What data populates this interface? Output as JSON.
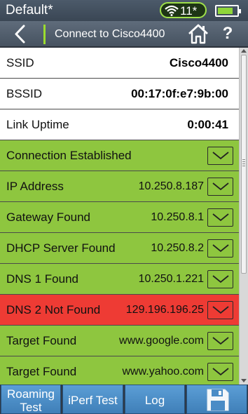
{
  "status_bar": {
    "profile": "Default*",
    "wifi_count": "11*",
    "wifi_icon": "wifi-icon",
    "battery_level": 0.8,
    "colors": {
      "wifi_accent": "#9fe04a",
      "battery_fill": "#8fd63a"
    }
  },
  "nav": {
    "back_icon": "chevron-left-icon",
    "title": "Connect to Cisco4400",
    "home_icon": "home-icon",
    "help_label": "?"
  },
  "rows": [
    {
      "label": "SSID",
      "value": "Cisco4400",
      "style": "white"
    },
    {
      "label": "BSSID",
      "value": "00:17:0f:e7:9b:00",
      "style": "white"
    },
    {
      "label": "Link Uptime",
      "value": "0:00:41",
      "style": "white"
    },
    {
      "label": "Connection Established",
      "value": "",
      "style": "green"
    },
    {
      "label": "IP Address",
      "value": "10.250.8.187",
      "style": "green"
    },
    {
      "label": "Gateway Found",
      "value": "10.250.8.1",
      "style": "green"
    },
    {
      "label": "DHCP Server Found",
      "value": "10.250.8.2",
      "style": "green"
    },
    {
      "label": "DNS 1 Found",
      "value": "10.250.1.221",
      "style": "green"
    },
    {
      "label": "DNS 2 Not Found",
      "value": "129.196.196.25",
      "style": "red"
    },
    {
      "label": "Target Found",
      "value": "www.google.com",
      "style": "green"
    },
    {
      "label": "Target Found",
      "value": "www.yahoo.com",
      "style": "green"
    }
  ],
  "colors": {
    "success": "#8ec63f",
    "failure": "#ee3b34",
    "toolbar_button": "#4a8cc6"
  },
  "toolbar": {
    "roaming_line1": "Roaming",
    "roaming_line2": "Test",
    "iperf": "iPerf Test",
    "log": "Log",
    "save_icon": "save-icon"
  }
}
